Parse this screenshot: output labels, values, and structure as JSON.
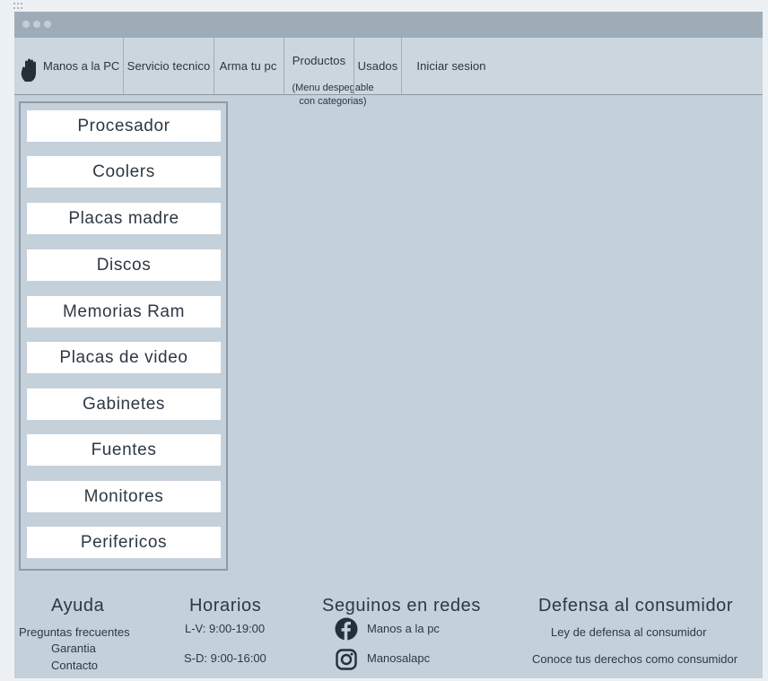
{
  "nav": {
    "brand": "Manos a la PC",
    "items": [
      "Servicio tecnico",
      "Arma tu pc",
      "Productos",
      "Usados",
      "Iniciar sesion"
    ],
    "productos_note_line1": "(Menu despegable",
    "productos_note_line2": "con categorias)"
  },
  "sidebar": {
    "categories": [
      "Procesador",
      "Coolers",
      "Placas madre",
      "Discos",
      "Memorias Ram",
      "Placas de video",
      "Gabinetes",
      "Fuentes",
      "Monitores",
      "Perifericos"
    ]
  },
  "footer": {
    "ayuda": {
      "title": "Ayuda",
      "links": [
        "Preguntas frecuentes",
        "Garantia",
        "Contacto"
      ]
    },
    "horarios": {
      "title": "Horarios",
      "lines": [
        "L-V: 9:00-19:00",
        "S-D: 9:00-16:00"
      ]
    },
    "redes": {
      "title": "Seguinos en redes",
      "facebook": "Manos a la pc",
      "instagram": "Manosalapc",
      "facebook_icon": "facebook-icon",
      "instagram_icon": "instagram-icon"
    },
    "consumidor": {
      "title": "Defensa al consumidor",
      "links": [
        "Ley de defensa al consumidor",
        "Conoce tus derechos como consumidor"
      ]
    }
  },
  "colors": {
    "background": "#c4d0da",
    "titlebar": "#9eacb8",
    "navbar": "#cbd6df",
    "button": "#ffffff"
  }
}
